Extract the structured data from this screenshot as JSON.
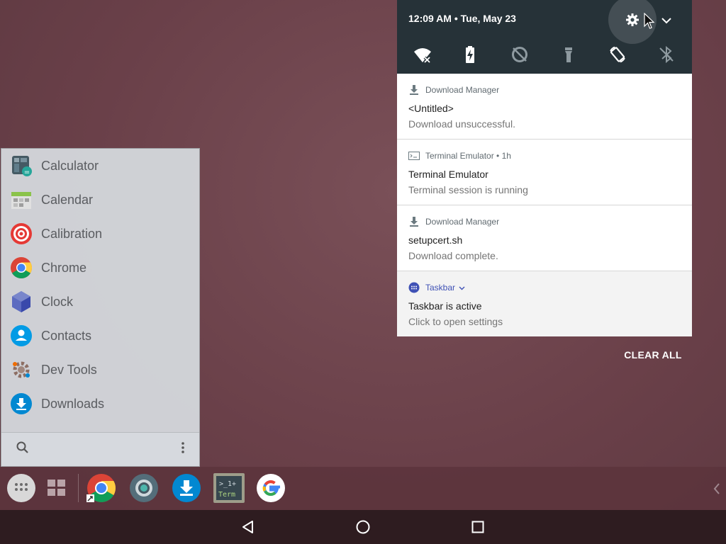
{
  "drawer": {
    "apps": [
      {
        "label": "Calculator",
        "icon": "calculator-icon"
      },
      {
        "label": "Calendar",
        "icon": "calendar-icon"
      },
      {
        "label": "Calibration",
        "icon": "target-icon"
      },
      {
        "label": "Chrome",
        "icon": "chrome-icon"
      },
      {
        "label": "Clock",
        "icon": "clock-icon"
      },
      {
        "label": "Contacts",
        "icon": "contacts-icon"
      },
      {
        "label": "Dev Tools",
        "icon": "gear-icon"
      },
      {
        "label": "Downloads",
        "icon": "download-icon"
      }
    ],
    "search_icon": "search-icon",
    "menu_icon": "more-vert-icon"
  },
  "taskbar": {
    "items": [
      "app-drawer-icon",
      "recents-grid-icon",
      "chrome-icon",
      "camera-icon",
      "downloads-icon",
      "terminal-icon",
      "google-icon"
    ],
    "terminal_label": "Term",
    "collapse_icon": "chevron-left-icon"
  },
  "navbar": {
    "back": "back-icon",
    "home": "home-icon",
    "recents": "recents-icon"
  },
  "shade": {
    "time_date": "12:09 AM • Tue, May 23",
    "quick_settings": [
      "wifi-off-icon",
      "battery-charging-icon",
      "data-saver-icon",
      "flashlight-icon",
      "auto-rotate-icon",
      "bluetooth-off-icon"
    ]
  },
  "notifications": [
    {
      "app": "Download Manager",
      "title": "<Untitled>",
      "text": "Download unsuccessful.",
      "icon": "download-icon"
    },
    {
      "app": "Terminal Emulator • 1h",
      "title": "Terminal Emulator",
      "text": "Terminal session is running",
      "icon": "terminal-icon"
    },
    {
      "app": "Download Manager",
      "title": "setupcert.sh",
      "text": "Download complete.",
      "icon": "download-icon"
    },
    {
      "app": "Taskbar",
      "title": "Taskbar is active",
      "text": "Click to open settings",
      "icon": "taskbar-icon"
    }
  ],
  "clear_all_label": "CLEAR ALL",
  "colors": {
    "wallpaper": "#6a4049",
    "shade_header": "#263238",
    "taskbar_accent": "#3f51b5",
    "download_blue": "#0288d1"
  }
}
